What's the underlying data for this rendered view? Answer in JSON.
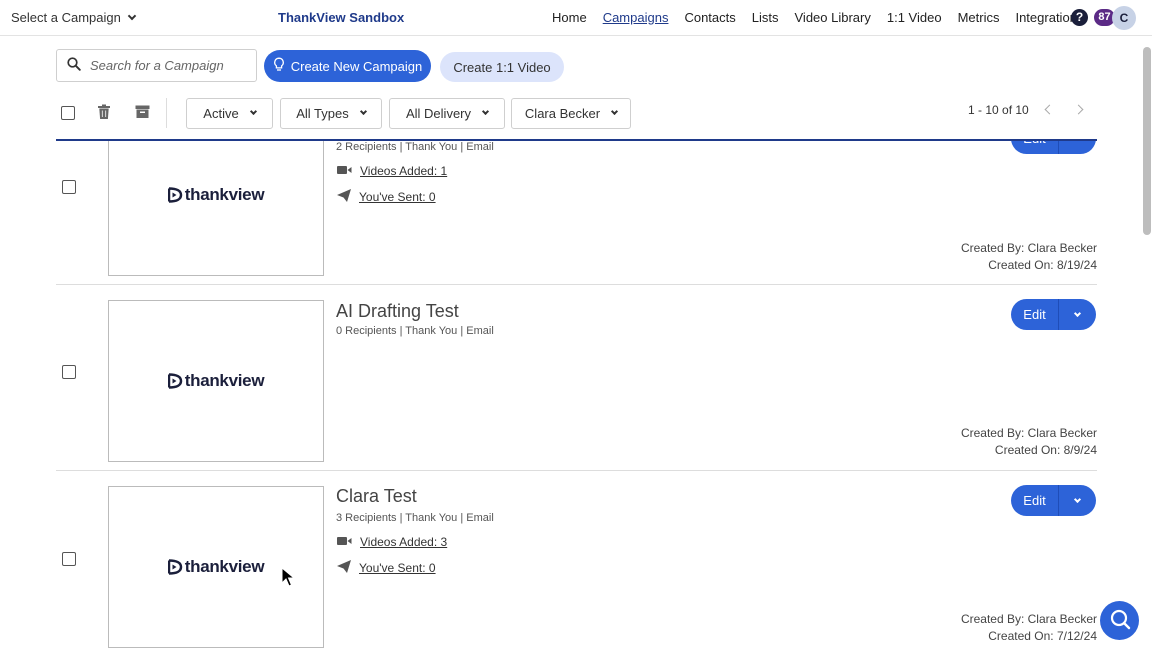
{
  "topnav": {
    "campaign_select": "Select a Campaign",
    "brand": "ThankView Sandbox",
    "links": [
      {
        "label": "Home",
        "active": false
      },
      {
        "label": "Campaigns",
        "active": true
      },
      {
        "label": "Contacts",
        "active": false
      },
      {
        "label": "Lists",
        "active": false
      },
      {
        "label": "Video Library",
        "active": false
      },
      {
        "label": "1:1 Video",
        "active": false
      },
      {
        "label": "Metrics",
        "active": false
      },
      {
        "label": "Integrations",
        "active": false
      }
    ],
    "help": "?",
    "notification_count": "87",
    "avatar_initial": "C"
  },
  "search": {
    "placeholder": "Search for a Campaign"
  },
  "buttons": {
    "create_campaign": "Create New Campaign",
    "create_one_to_one": "Create 1:1 Video"
  },
  "filters": {
    "status": "Active",
    "types": "All Types",
    "delivery": "All Delivery",
    "owner": "Clara Becker"
  },
  "pagination": "1 - 10 of 10",
  "logo_text": "thankview",
  "edit_label": "Edit",
  "campaigns": [
    {
      "title": "",
      "meta": "2 Recipients | Thank You | Email",
      "videos_added": "Videos Added: 1",
      "sent": "You've Sent: 0",
      "created_by": "Created By: Clara Becker",
      "created_on": "Created On: 8/19/24"
    },
    {
      "title": "AI Drafting Test",
      "meta": "0 Recipients | Thank You | Email",
      "videos_added": "",
      "sent": "",
      "created_by": "Created By: Clara Becker",
      "created_on": "Created On: 8/9/24"
    },
    {
      "title": "Clara Test",
      "meta": "3 Recipients | Thank You | Email",
      "videos_added": "Videos Added: 3",
      "sent": "You've Sent: 0",
      "created_by": "Created By: Clara Becker",
      "created_on": "Created On: 7/12/24"
    }
  ],
  "colors": {
    "primary": "#2d63d8",
    "brand_navy": "#1f3a8a",
    "secondary_button": "#dce4fb",
    "badge": "#5b2a86"
  }
}
